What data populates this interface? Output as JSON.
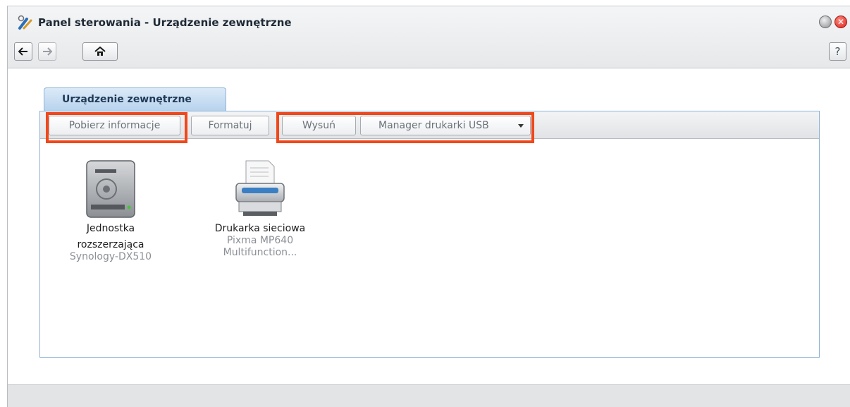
{
  "window": {
    "title": "Panel sterowania - Urządzenie zewnętrzne",
    "help_label": "?",
    "close_glyph": "✕"
  },
  "tabs": [
    {
      "label": "Urządzenie zewnętrzne",
      "active": true
    }
  ],
  "toolbar": {
    "info_label": "Pobierz informacje",
    "format_label": "Formatuj",
    "eject_label": "Wysuń",
    "printer_manager_label": "Manager drukarki USB"
  },
  "devices": [
    {
      "name": "Jednostka rozszerzająca",
      "name_line1": "Jednostka",
      "name_line2": "rozszerzająca",
      "detail_line1": "Synology-DX510",
      "icon": "hard-drive-icon"
    },
    {
      "name": "Drukarka sieciowa",
      "name_line1": "Drukarka sieciowa",
      "detail_line1": "Pixma MP640",
      "detail_line2": "Multifunction...",
      "icon": "printer-icon"
    }
  ],
  "icons": {
    "app": "control-panel-icon",
    "back": "arrow-left-icon",
    "forward": "arrow-right-icon",
    "home": "home-icon",
    "minimize": "minimize-icon",
    "close": "close-icon",
    "dropdown": "caret-down-icon"
  },
  "colors": {
    "highlight": "#f0471b",
    "tab_bg": "#b7d2ed",
    "close_red": "#d8231b"
  }
}
